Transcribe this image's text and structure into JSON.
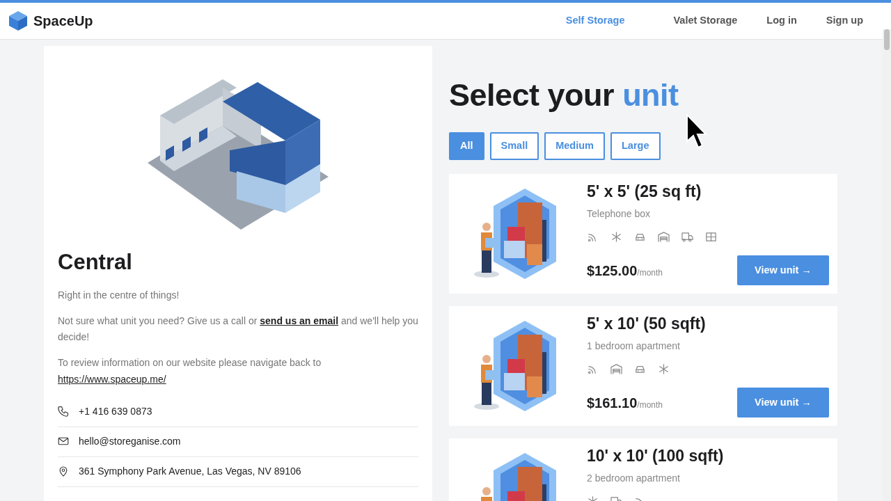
{
  "nav": {
    "brand": "SpaceUp",
    "links": [
      {
        "label": "Self Storage",
        "selected": true
      },
      {
        "label": "Valet Storage",
        "selected": false
      },
      {
        "label": "Log in",
        "selected": false
      },
      {
        "label": "Sign up",
        "selected": false
      }
    ]
  },
  "location": {
    "name": "Central",
    "tagline": "Right in the centre of things!",
    "help": {
      "before": "Not sure what unit you need? Give us a call or ",
      "link": "send us an email",
      "after": " and we'll help you decide!"
    },
    "website": {
      "text": "To review information on our website please navigate back to ",
      "link": "https://www.spaceup.me/"
    },
    "contacts": [
      {
        "kind": "phone",
        "text": "+1 416 639 0873"
      },
      {
        "kind": "email",
        "text": "hello@storeganise.com"
      },
      {
        "kind": "address",
        "text": "361 Symphony Park Avenue, Las Vegas, NV 89106"
      }
    ]
  },
  "heading": {
    "text": "Select your",
    "highlight": "unit"
  },
  "filters": [
    {
      "label": "All",
      "selected": true
    },
    {
      "label": "Small",
      "selected": false
    },
    {
      "label": "Medium",
      "selected": false
    },
    {
      "label": "Large",
      "selected": false
    }
  ],
  "units": [
    {
      "size": "5' x 5' (25 sq ft)",
      "description": "Telephone box",
      "amenities": [
        {
          "kind": "wifi"
        },
        {
          "kind": "snowflake"
        },
        {
          "kind": "car"
        },
        {
          "kind": "garage"
        },
        {
          "kind": "truck"
        },
        {
          "kind": "window"
        }
      ],
      "price": "$125.00",
      "period": "/month",
      "button": "View unit →"
    },
    {
      "size": "5' x 10' (50 sqft)",
      "description": "1 bedroom apartment",
      "amenities": [
        {
          "kind": "wifi"
        },
        {
          "kind": "garage"
        },
        {
          "kind": "car"
        },
        {
          "kind": "snowflake"
        }
      ],
      "price": "$161.10",
      "period": "/month",
      "button": "View unit →"
    },
    {
      "size": "10' x 10' (100 sqft)",
      "description": "2 bedroom apartment",
      "amenities": [
        {
          "kind": "snowflake"
        },
        {
          "kind": "truck"
        },
        {
          "kind": "wifi"
        }
      ]
    }
  ]
}
